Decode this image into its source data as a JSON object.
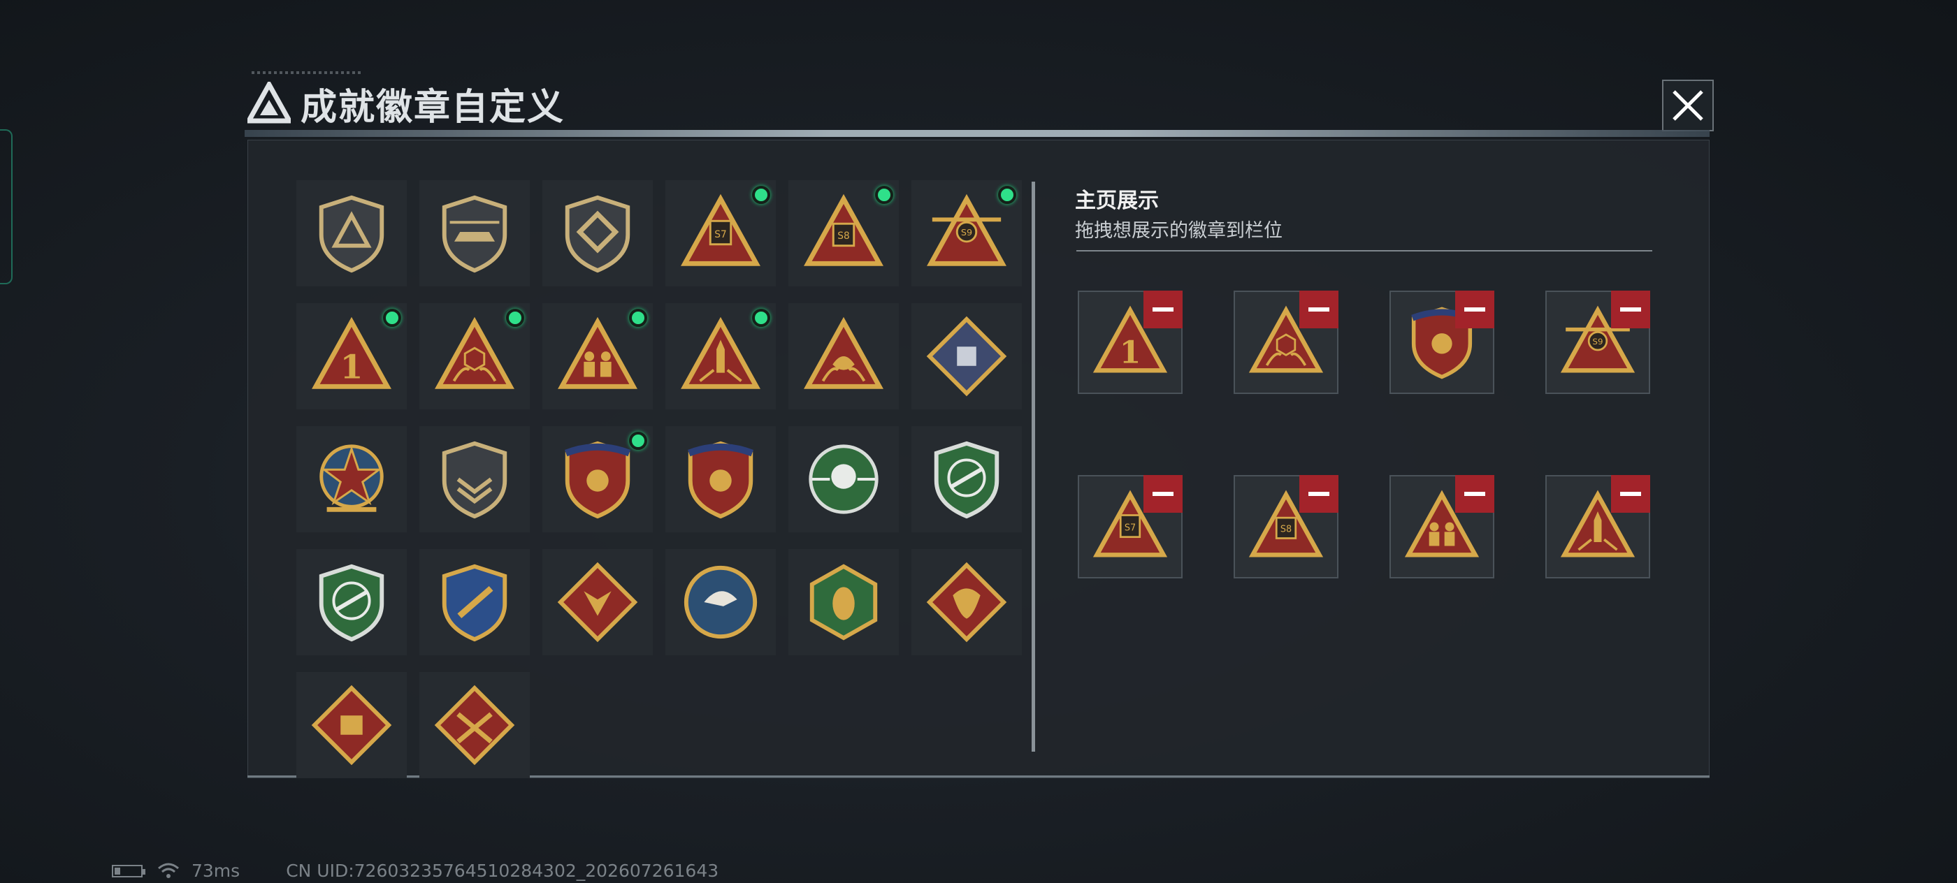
{
  "window": {
    "title": "成就徽章自定义"
  },
  "badges": [
    {
      "icon": "delta-shield-badge",
      "new": false
    },
    {
      "icon": "helicopter-shield-badge",
      "new": false
    },
    {
      "icon": "diamond-emblem-shield-badge",
      "new": false
    },
    {
      "icon": "s7-triangle-badge",
      "new": true
    },
    {
      "icon": "s8-triangle-badge",
      "new": true
    },
    {
      "icon": "s9-winged-triangle-badge",
      "new": true
    },
    {
      "icon": "number-one-triangle-badge",
      "new": true
    },
    {
      "icon": "hexagon-hands-triangle-badge",
      "new": true
    },
    {
      "icon": "squad-triangle-badge",
      "new": true
    },
    {
      "icon": "rocket-triangle-badge",
      "new": true
    },
    {
      "icon": "fish-hands-triangle-badge",
      "new": false
    },
    {
      "icon": "fist-diamond-badge",
      "new": false
    },
    {
      "icon": "star-medal-badge",
      "new": false
    },
    {
      "icon": "chevron-shield-badge",
      "new": false
    },
    {
      "icon": "starred-laurel-shield-badge",
      "new": true
    },
    {
      "icon": "starred-gem-shield-badge",
      "new": false
    },
    {
      "icon": "skull-crosshair-badge",
      "new": false
    },
    {
      "icon": "rifle-crosshair-shield-badge",
      "new": false
    },
    {
      "icon": "rifle-crosshair-green-badge",
      "new": false
    },
    {
      "icon": "rocket-gold-shield-badge",
      "new": false
    },
    {
      "icon": "wolf-diamond-badge",
      "new": false
    },
    {
      "icon": "eagle-circle-badge",
      "new": false
    },
    {
      "icon": "wasp-hexagon-badge",
      "new": false
    },
    {
      "icon": "dragon-diamond-badge",
      "new": false
    },
    {
      "icon": "fist-red-diamond-badge",
      "new": false
    },
    {
      "icon": "crossed-rifles-diamond-badge",
      "new": false
    }
  ],
  "homepage": {
    "title": "主页展示",
    "subtitle": "拖拽想展示的徽章到栏位",
    "slots": [
      {
        "icon": "number-one-triangle-badge"
      },
      {
        "icon": "hexagon-hands-triangle-badge"
      },
      {
        "icon": "starred-laurel-shield-badge"
      },
      {
        "icon": "s9-winged-triangle-badge"
      },
      {
        "icon": "s7-triangle-badge"
      },
      {
        "icon": "s8-triangle-badge"
      },
      {
        "icon": "squad-triangle-badge"
      },
      {
        "icon": "rocket-triangle-badge"
      }
    ]
  },
  "status": {
    "ping": "73ms",
    "uid": "CN UID:7260323576451028430​2_202607261643"
  },
  "colors": {
    "accent_green": "#2fe08a",
    "remove_red": "#a3232a",
    "gold": "#d6a84a"
  }
}
